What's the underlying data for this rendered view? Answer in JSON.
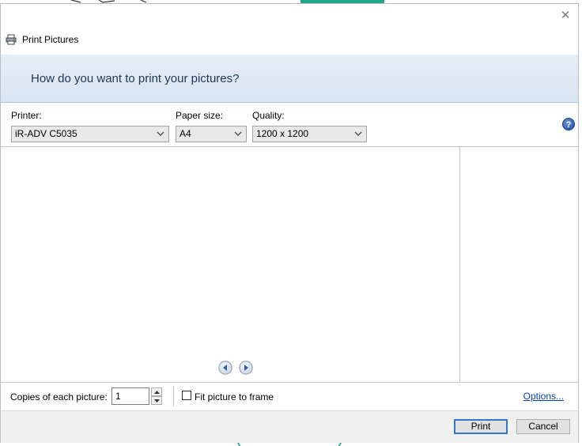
{
  "dialog": {
    "title": "Print Pictures",
    "close_glyph": "✕",
    "question": "How do you want to print your pictures?"
  },
  "settings": {
    "printer_label": "Printer:",
    "printer_value": "iR-ADV C5035",
    "paper_label": "Paper size:",
    "paper_value": "A4",
    "quality_label": "Quality:",
    "quality_value": "1200 x 1200",
    "help_glyph": "?"
  },
  "options": {
    "copies_label": "Copies of each picture:",
    "copies_value": "1",
    "fit_label": "Fit picture to frame",
    "fit_checked": false,
    "options_link": "Options..."
  },
  "footer": {
    "print_label": "Print",
    "cancel_label": "Cancel"
  },
  "icons": {
    "title": "printer-icon",
    "close": "close-icon",
    "help": "help-icon",
    "dropdown": "chevron-down-icon",
    "prev": "arrow-left-icon",
    "next": "arrow-right-icon",
    "spin_up": "spin-up-icon",
    "spin_down": "spin-down-icon"
  },
  "colors": {
    "banner_text": "#1e3553",
    "link": "#0645ad",
    "default_button_border": "#3278c6"
  }
}
